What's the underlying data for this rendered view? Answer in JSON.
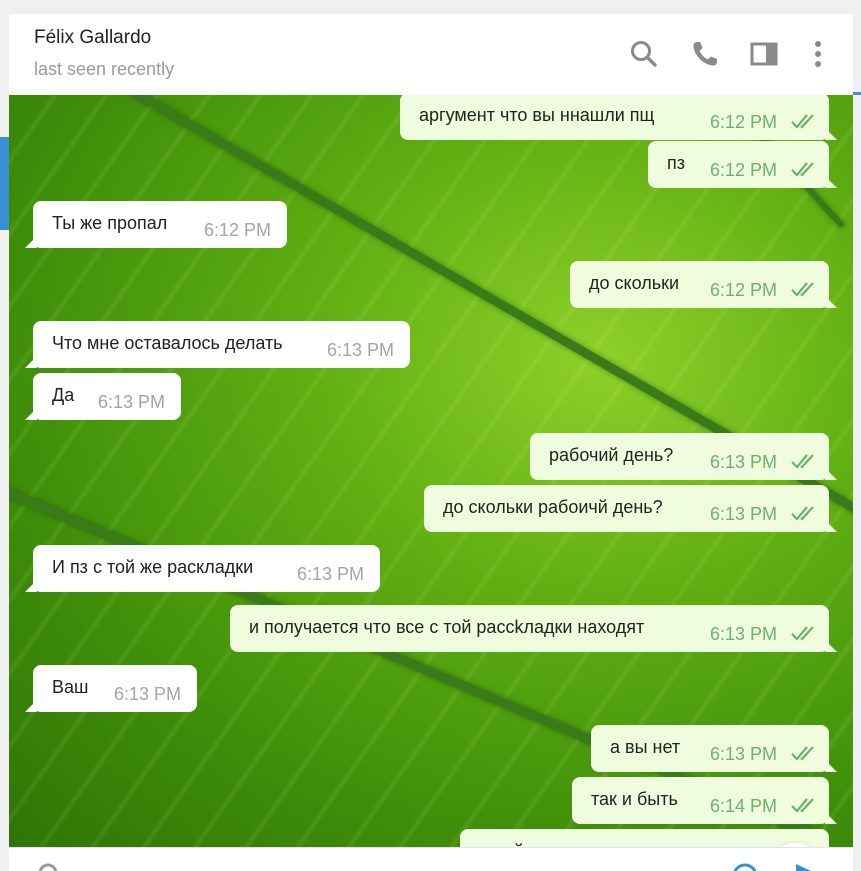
{
  "header": {
    "name": "Félix Gallardo",
    "status": "last seen recently",
    "icons": [
      "search-icon",
      "phone-icon",
      "sidebar-toggle-icon",
      "more-vertical-icon"
    ]
  },
  "colors": {
    "accent": "#3a8fd6",
    "incoming_bubble": "#ffffff",
    "outgoing_bubble": "#effdde",
    "outgoing_meta": "#6cb36a",
    "incoming_meta": "#a4a4a4"
  },
  "messages": [
    {
      "dir": "out",
      "text": "аргумент что вы ннашли пщ",
      "time": "6:12 PM",
      "read": true
    },
    {
      "dir": "out",
      "text": "пз",
      "time": "6:12 PM",
      "read": true
    },
    {
      "dir": "in",
      "text": "Ты же пропал",
      "time": "6:12 PM"
    },
    {
      "dir": "out",
      "text": "до скольки",
      "time": "6:12 PM",
      "read": true
    },
    {
      "dir": "in",
      "text": "Что мне оставалось делать",
      "time": "6:13 PM"
    },
    {
      "dir": "in",
      "text": "Да",
      "time": "6:13 PM"
    },
    {
      "dir": "out",
      "text": "рабочий день?",
      "time": "6:13 PM",
      "read": true
    },
    {
      "dir": "out",
      "text": "до скольки рабоичй день?",
      "time": "6:13 PM",
      "read": true
    },
    {
      "dir": "in",
      "text": "И пз с той же раскладки",
      "time": "6:13 PM"
    },
    {
      "dir": "out",
      "text": "и получается что все с той рассkладки находят",
      "time": "6:13 PM",
      "read": true
    },
    {
      "dir": "in",
      "text": "Ваш",
      "time": "6:13 PM"
    },
    {
      "dir": "out",
      "text": "а вы нет",
      "time": "6:13 PM",
      "read": true
    },
    {
      "dir": "out",
      "text": "так и быть",
      "time": "6:14 PM",
      "read": true
    },
    {
      "dir": "out",
      "text": "а пойду вам не встречу",
      "time": "",
      "read": false
    }
  ],
  "scroll_down": {
    "icon": "chevron-down-icon"
  },
  "composer": {
    "icons": [
      "attach-icon",
      "emoji-icon",
      "send-icon"
    ]
  }
}
